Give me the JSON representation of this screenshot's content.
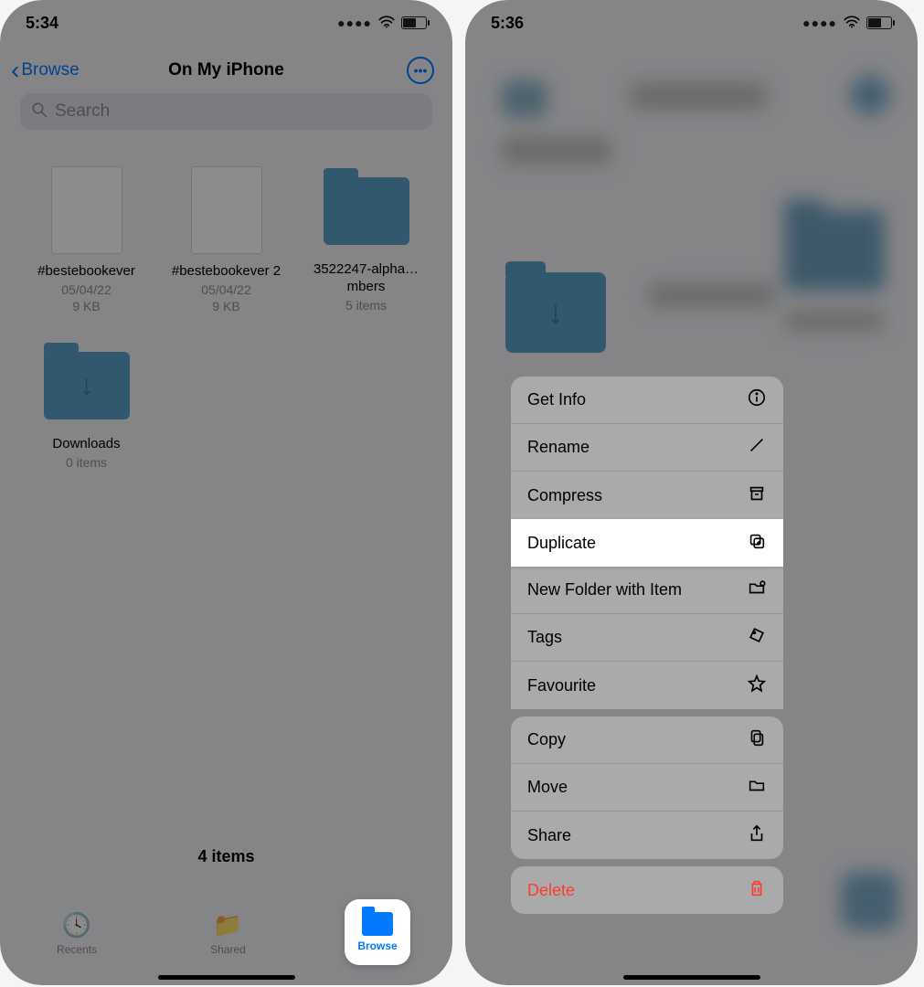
{
  "left": {
    "status_time": "5:34",
    "back_label": "Browse",
    "title": "On My iPhone",
    "search_placeholder": "Search",
    "files": [
      {
        "name": "#bestebookever",
        "date": "05/04/22",
        "size": "9 KB",
        "type": "doc"
      },
      {
        "name": "#bestebookever 2",
        "date": "05/04/22",
        "size": "9 KB",
        "type": "doc"
      },
      {
        "name": "3522247-alpha…mbers",
        "meta": "5 items",
        "type": "folder"
      },
      {
        "name": "Downloads",
        "meta": "0 items",
        "type": "folder-download"
      }
    ],
    "footer_count": "4 items",
    "tabs": {
      "recents": "Recents",
      "shared": "Shared",
      "browse": "Browse"
    }
  },
  "right": {
    "status_time": "5:36",
    "menu": {
      "group1": [
        {
          "label": "Get Info",
          "icon": "info"
        },
        {
          "label": "Rename",
          "icon": "pencil"
        },
        {
          "label": "Compress",
          "icon": "archive"
        },
        {
          "label": "Duplicate",
          "icon": "duplicate",
          "highlight": true
        },
        {
          "label": "New Folder with Item",
          "icon": "new-folder"
        },
        {
          "label": "Tags",
          "icon": "tag"
        },
        {
          "label": "Favourite",
          "icon": "star"
        }
      ],
      "group2": [
        {
          "label": "Copy",
          "icon": "copy"
        },
        {
          "label": "Move",
          "icon": "folder"
        },
        {
          "label": "Share",
          "icon": "share"
        }
      ],
      "group3": [
        {
          "label": "Delete",
          "icon": "trash",
          "destructive": true
        }
      ]
    }
  }
}
